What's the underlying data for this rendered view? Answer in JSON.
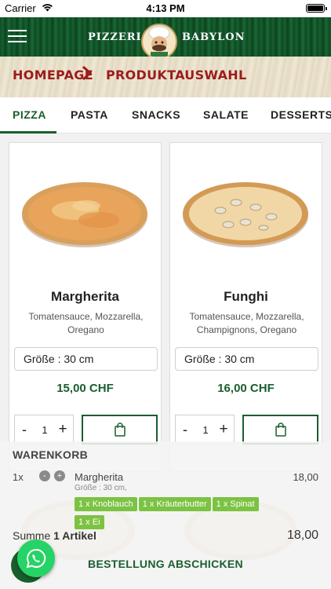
{
  "status_bar": {
    "carrier": "Carrier",
    "time": "4:13 PM"
  },
  "header": {
    "logo_left": "PIZZERIA",
    "logo_right": "BABYLON",
    "logo_icon": "chef-icon",
    "menu_icon": "hamburger-menu-icon"
  },
  "breadcrumb": {
    "home": "HOMEPAGE",
    "current": "PRODUKTAUSWAHL"
  },
  "tabs": [
    {
      "label": "PIZZA",
      "active": true
    },
    {
      "label": "PASTA",
      "active": false
    },
    {
      "label": "SNACKS",
      "active": false
    },
    {
      "label": "SALATE",
      "active": false
    },
    {
      "label": "DESSERTS",
      "active": false
    }
  ],
  "products": [
    {
      "name": "Margherita",
      "description": "Tomatensauce, Mozzarella, Oregano",
      "size": "Größe : 30 cm",
      "price": "15,00 CHF",
      "quantity": "1",
      "minus": "-",
      "plus": "+"
    },
    {
      "name": "Funghi",
      "description": "Tomatensauce, Mozzarella, Champignons, Oregano",
      "size": "Größe : 30 cm",
      "price": "16,00 CHF",
      "quantity": "1",
      "minus": "-",
      "plus": "+"
    }
  ],
  "cart": {
    "title": "WARENKORB",
    "item": {
      "qty": "1x",
      "minus": "-",
      "plus": "+",
      "name": "Margherita",
      "size": "Größe : 30 cm,",
      "price": "18,00",
      "extras": [
        "1 x Knoblauch",
        "1 x Kräuterbutter",
        "1 x Spinat",
        "1 x Ei"
      ]
    },
    "sum_prefix": "Summe",
    "sum_count": "1 Artikel",
    "sum_total": "18,00",
    "checkout_label": "BESTELLUNG ABSCHICKEN"
  },
  "colors": {
    "brand_green": "#1a5e2e",
    "breadcrumb_red": "#9b1c1c",
    "extra_tag": "#7cc243",
    "whatsapp": "#25d366"
  }
}
